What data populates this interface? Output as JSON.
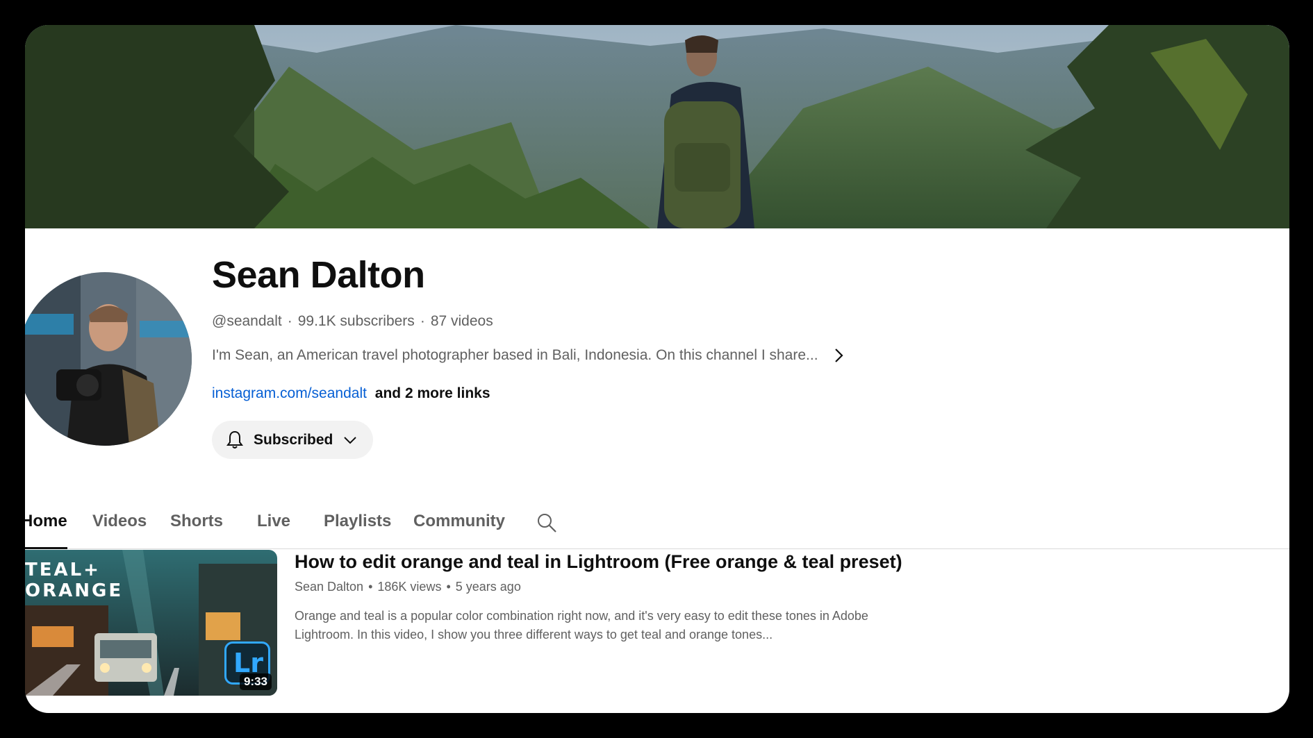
{
  "channel": {
    "name": "Sean Dalton",
    "handle": "@seandalt",
    "subscribers": "99.1K subscribers",
    "videos": "87 videos",
    "description": "I'm Sean, an American travel photographer based in Bali, Indonesia. On this channel I share...",
    "link": "instagram.com/seandalt",
    "more_links": "and 2 more links",
    "meta_separator": "·"
  },
  "subscribe": {
    "label": "Subscribed",
    "icon": "bell-icon"
  },
  "tabs": [
    {
      "label": "Home",
      "active": true
    },
    {
      "label": "Videos",
      "active": false
    },
    {
      "label": "Shorts",
      "active": false
    },
    {
      "label": "Live",
      "active": false
    },
    {
      "label": "Playlists",
      "active": false
    },
    {
      "label": "Community",
      "active": false
    }
  ],
  "featured_video": {
    "title": "How to edit orange and teal in Lightroom (Free orange & teal preset)",
    "author": "Sean Dalton",
    "views": "186K views",
    "age": "5 years ago",
    "meta_separator": "•",
    "description": "Orange and teal is a popular color combination right now, and it's very easy to edit these tones in Adobe Lightroom. In this video, I show you three different ways to get teal and orange tones...",
    "duration": "9:33",
    "thumb_line1": "TEAL+",
    "thumb_line2": "ORANGE",
    "badge": "Lr"
  },
  "colors": {
    "link": "#065fd4",
    "text_primary": "#0f0f0f",
    "text_secondary": "#606060",
    "button_bg": "#f2f2f2",
    "lightroom_blue": "#31a8ff"
  }
}
